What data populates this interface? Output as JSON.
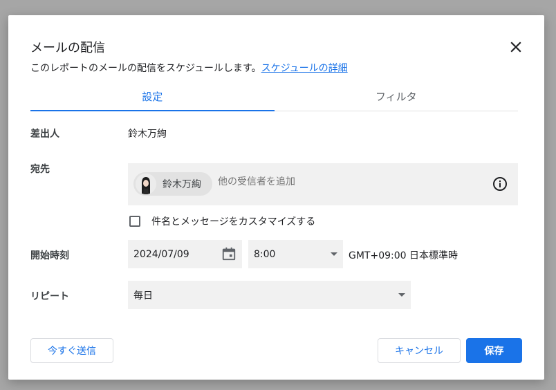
{
  "dialog": {
    "title": "メールの配信",
    "subtitle": "このレポートのメールの配信をスケジュールします。",
    "subtitle_link": "スケジュールの詳細"
  },
  "tabs": [
    {
      "label": "設定",
      "active": true
    },
    {
      "label": "フィルタ",
      "active": false
    }
  ],
  "sender": {
    "label": "差出人",
    "value": "鈴木万絢"
  },
  "recipients": {
    "label": "宛先",
    "chips": [
      {
        "name": "鈴木万絢"
      }
    ],
    "placeholder": "他の受信者を追加"
  },
  "customize": {
    "label": "件名とメッセージをカスタマイズする",
    "checked": false
  },
  "start_time": {
    "label": "開始時刻",
    "date": "2024/07/09",
    "time": "8:00",
    "timezone": "GMT+09:00 日本標準時"
  },
  "repeat": {
    "label": "リピート",
    "value": "毎日"
  },
  "buttons": {
    "send_now": "今すぐ送信",
    "cancel": "キャンセル",
    "save": "保存"
  },
  "colors": {
    "accent": "#1a73e8",
    "field_bg": "#f1f1f1",
    "overlay": "#a6a6a6"
  }
}
